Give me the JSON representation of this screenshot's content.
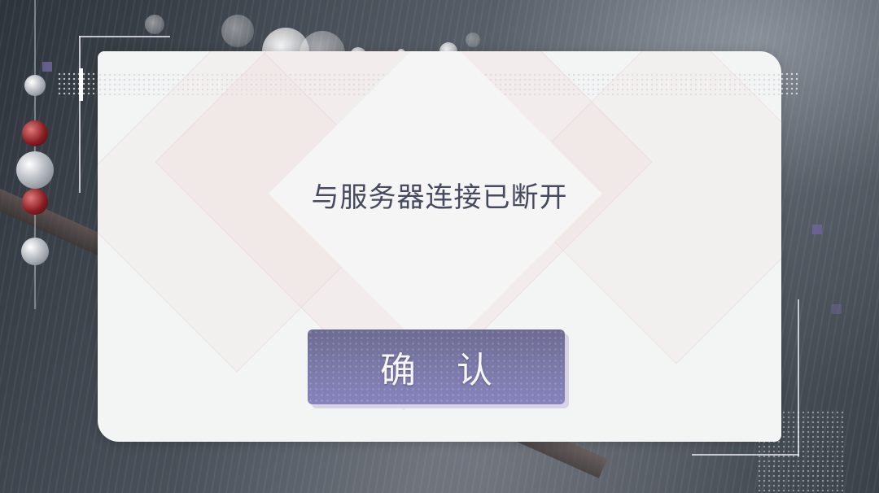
{
  "dialog": {
    "message": "与服务器连接已断开",
    "confirm_label": "确 认"
  },
  "colors": {
    "dialog_bg": "#f3f4f4",
    "message_text": "#454a5f",
    "button_top": "#6d6b92",
    "button_bottom": "#8683bd",
    "accent_square": "#6d6596"
  },
  "icons": {
    "decorative": [
      "bokeh-light",
      "bead-ornament",
      "corner-frame-line",
      "dot-pattern"
    ]
  }
}
